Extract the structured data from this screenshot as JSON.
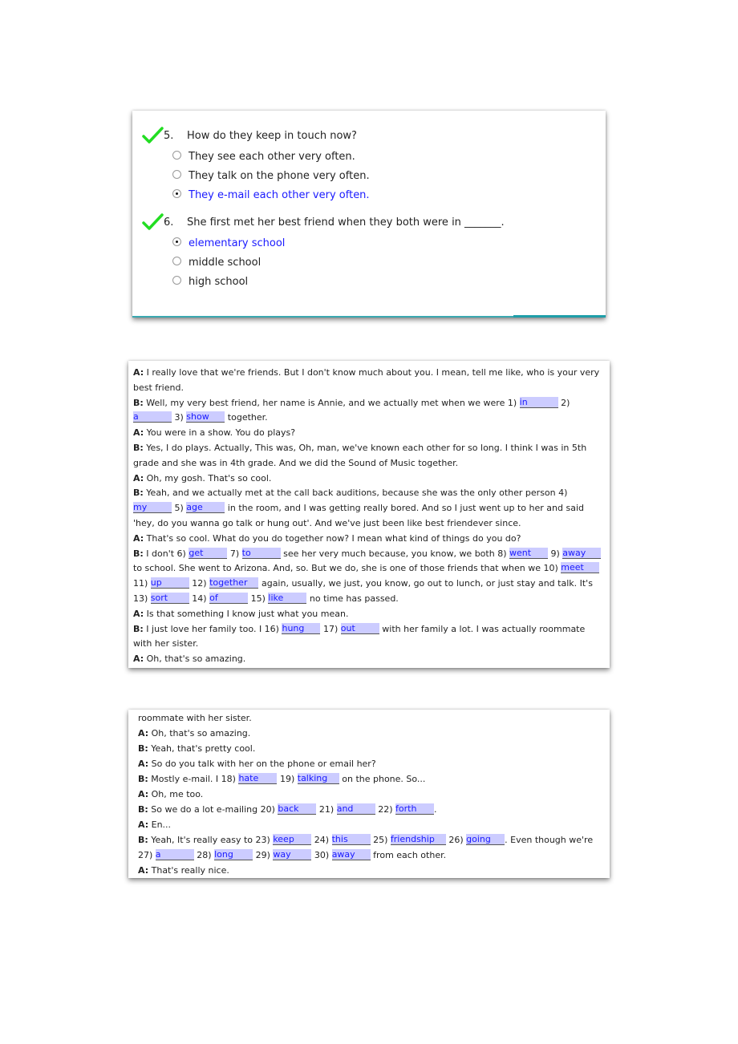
{
  "colors": {
    "check": "#22dd22",
    "selected_text": "#1a1aff",
    "blank_bg": "#ccccff",
    "accent_line": "#3aa8b0"
  },
  "quiz": {
    "questions": [
      {
        "number": "5.",
        "text": "How do they keep in touch now?",
        "status_icon": "checkmark-icon",
        "options": [
          {
            "text": "They see each other very often.",
            "selected": false
          },
          {
            "text": "They talk on the phone very often.",
            "selected": false
          },
          {
            "text": "They e-mail each other very often.",
            "selected": true
          }
        ]
      },
      {
        "number": "6.",
        "text": "She first met her best friend when they both were in _______.",
        "status_icon": "checkmark-icon",
        "options": [
          {
            "text": "elementary school",
            "selected": true
          },
          {
            "text": "middle school",
            "selected": false
          },
          {
            "text": "high school",
            "selected": false
          }
        ]
      }
    ]
  },
  "dialogue1": [
    {
      "s": "A:",
      "p": [
        " I really love that we're friends. But I don't know much about you. I mean, tell me like, who is your very best friend."
      ]
    },
    {
      "s": "B:",
      "p": [
        " Well, my very best friend, her name is Annie, and we actually met when we were 1) ",
        {
          "n": "1",
          "a": "in"
        },
        " 2) ",
        {
          "n": "2",
          "a": "a"
        },
        " 3) ",
        {
          "n": "3",
          "a": "show"
        },
        " together."
      ]
    },
    {
      "s": "A:",
      "p": [
        " You were in a show. You do plays?"
      ]
    },
    {
      "s": "B:",
      "p": [
        " Yes, I do plays. Actually, This was, Oh, man, we've known each other for so long. I think I was in 5th grade and she was in 4th grade. And we did the Sound of Music together."
      ]
    },
    {
      "s": "A:",
      "p": [
        " Oh, my gosh. That's so cool."
      ]
    },
    {
      "s": "B:",
      "p": [
        " Yeah, and we actually met at the call back auditions, because she was the only other person 4) ",
        {
          "n": "4",
          "a": "my"
        },
        " 5) ",
        {
          "n": "5",
          "a": "age"
        },
        " in the room, and I was getting really bored. And so I just went up to her and said 'hey, do you wanna go talk or hung out'. And we've just been like best friendever since."
      ]
    },
    {
      "s": "A:",
      "p": [
        " That's so cool. What do you do together now? I mean what kind of things do you do?"
      ]
    },
    {
      "s": "B:",
      "p": [
        " I don't 6) ",
        {
          "n": "6",
          "a": "get"
        },
        " 7) ",
        {
          "n": "7",
          "a": "to"
        },
        " see her very much because, you know, we both 8) ",
        {
          "n": "8",
          "a": "went"
        },
        " 9) ",
        {
          "n": "9",
          "a": "away"
        },
        " to school. She went to Arizona. And, so. But we do, she is one of those friends that when we 10) ",
        {
          "n": "10",
          "a": "meet"
        },
        " 11) ",
        {
          "n": "11",
          "a": "up"
        },
        " 12) ",
        {
          "n": "12",
          "a": "together"
        },
        " again, usually, we just, you know, go out to lunch, or just stay and talk. It's 13) ",
        {
          "n": "13",
          "a": "sort"
        },
        " 14) ",
        {
          "n": "14",
          "a": "of"
        },
        " 15) ",
        {
          "n": "15",
          "a": "like"
        },
        " no time has passed."
      ]
    },
    {
      "s": "A:",
      "p": [
        " Is that something I know just what you mean."
      ]
    },
    {
      "s": "B:",
      "p": [
        " I just love her family too. I 16) ",
        {
          "n": "16",
          "a": "hung"
        },
        " 17) ",
        {
          "n": "17",
          "a": "out"
        },
        " with her family a lot. I was actually roommate with her sister."
      ]
    },
    {
      "s": "A:",
      "p": [
        " Oh, that's so amazing."
      ]
    }
  ],
  "dialogue2": [
    {
      "s": "",
      "p": [
        "roommate with her sister."
      ]
    },
    {
      "s": "A:",
      "p": [
        " Oh, that's so amazing."
      ]
    },
    {
      "s": "B:",
      "p": [
        " Yeah, that's pretty cool."
      ]
    },
    {
      "s": "A:",
      "p": [
        " So do you talk with her on the phone or email her?"
      ]
    },
    {
      "s": "B:",
      "p": [
        " Mostly e-mail. I 18) ",
        {
          "n": "18",
          "a": "hate"
        },
        " 19) ",
        {
          "n": "19",
          "a": "talking"
        },
        " on the phone. So..."
      ]
    },
    {
      "s": "A:",
      "p": [
        " Oh, me too."
      ]
    },
    {
      "s": "B:",
      "p": [
        " So we do a lot e-mailing 20) ",
        {
          "n": "20",
          "a": "back"
        },
        " 21) ",
        {
          "n": "21",
          "a": "and"
        },
        " 22) ",
        {
          "n": "22",
          "a": "forth"
        },
        "."
      ]
    },
    {
      "s": "A:",
      "p": [
        " En..."
      ]
    },
    {
      "s": "B:",
      "p": [
        " Yeah, It's really easy to 23) ",
        {
          "n": "23",
          "a": "keep"
        },
        " 24) ",
        {
          "n": "24",
          "a": "this"
        },
        " 25) ",
        {
          "n": "25",
          "a": "friendship"
        },
        " 26) ",
        {
          "n": "26",
          "a": "going"
        },
        ". Even though we're 27) ",
        {
          "n": "27",
          "a": "a"
        },
        " 28) ",
        {
          "n": "28",
          "a": "long"
        },
        " 29) ",
        {
          "n": "29",
          "a": "way"
        },
        " 30) ",
        {
          "n": "30",
          "a": "away"
        },
        " from each other."
      ]
    },
    {
      "s": "A:",
      "p": [
        " That's really nice."
      ]
    }
  ]
}
